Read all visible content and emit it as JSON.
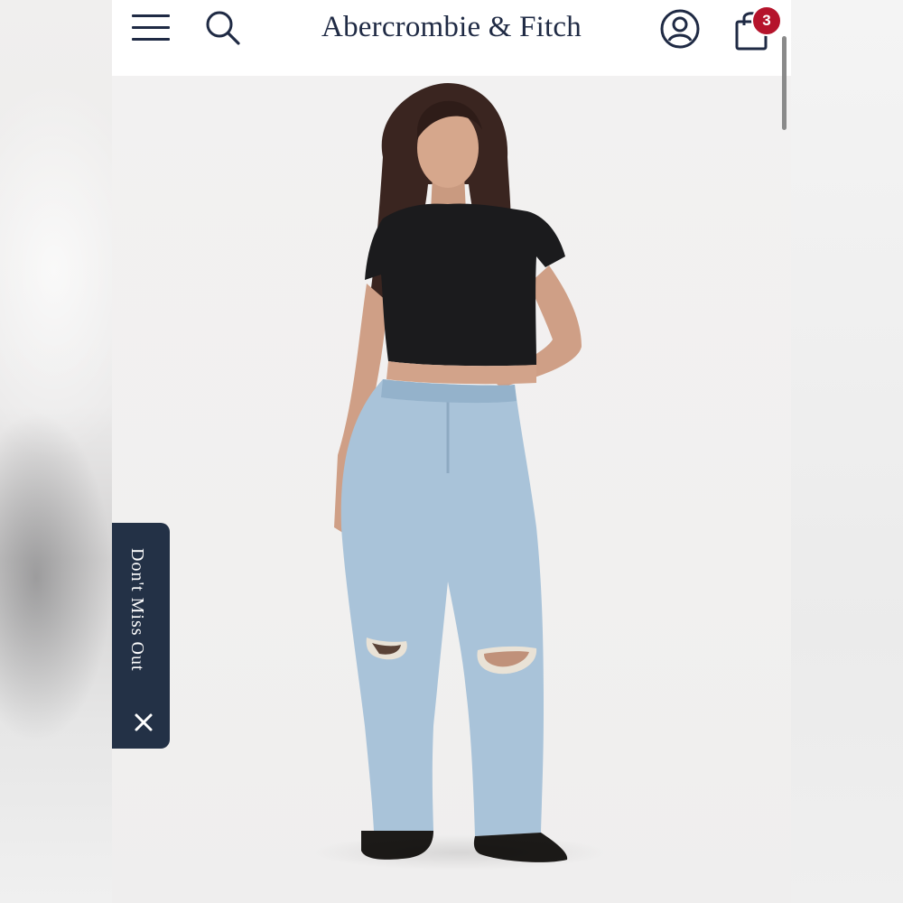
{
  "header": {
    "logo_text": "Abercrombie & Fitch",
    "cart_count": "3",
    "icons": [
      "menu-icon",
      "search-icon",
      "account-icon",
      "shopping-bag-icon"
    ]
  },
  "promo_tab": {
    "label": "Don't Miss Out",
    "close_icon": "close-icon"
  },
  "product_image": {
    "description_icon": "model-photo"
  },
  "colors": {
    "brand_navy": "#1f2a44",
    "badge_red": "#b5132b",
    "promo_tab_bg": "#233146"
  }
}
